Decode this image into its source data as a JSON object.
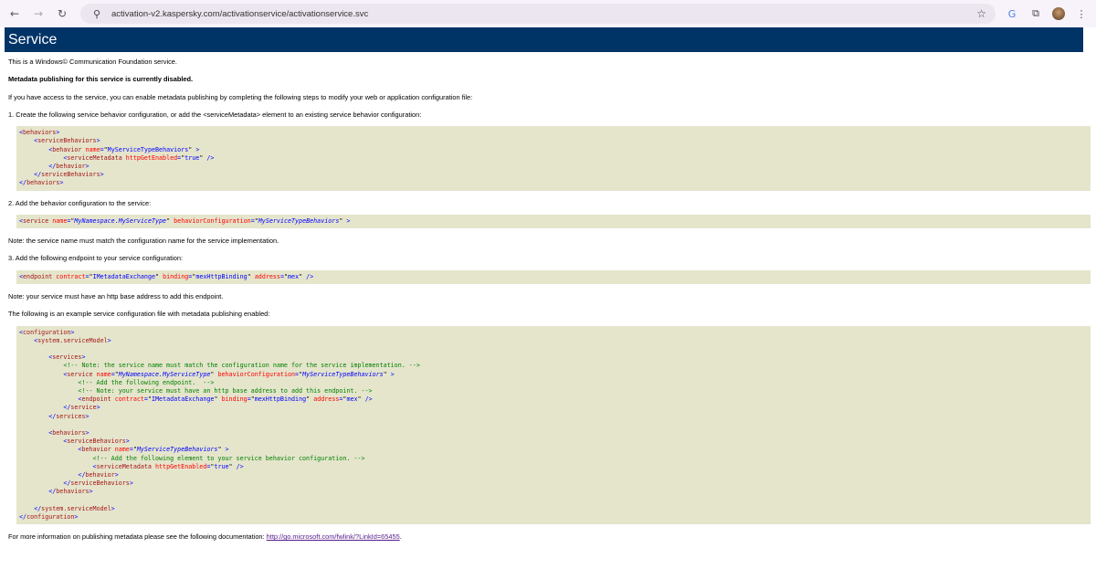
{
  "browser": {
    "url": "activation-v2.kaspersky.com/activationservice/activationservice.svc"
  },
  "page": {
    "title": "Service",
    "intro": "This is a Windows© Communication Foundation service.",
    "disabled": "Metadata publishing for this service is currently disabled.",
    "access": "If you have access to the service, you can enable metadata publishing by completing the following steps to modify your web or application configuration file:",
    "step1": "1. Create the following service behavior configuration, or add the <serviceMetadata> element to an existing service behavior configuration:",
    "step2": "2. Add the behavior configuration to the service:",
    "note1": "Note: the service name must match the configuration name for the service implementation.",
    "step3": "3. Add the following endpoint to your service configuration:",
    "note2": "Note: your service must have an http base address to add this endpoint.",
    "example": "The following is an example service configuration file with metadata publishing enabled:",
    "more": "For more information on publishing metadata please see the following documentation: ",
    "link": "http://go.microsoft.com/fwlink/?LinkId=65455",
    "link_end": "."
  },
  "code1": [
    [
      [
        "br",
        "<"
      ],
      [
        "tg",
        "behaviors"
      ],
      [
        "br",
        ">"
      ]
    ],
    [
      [
        "",
        "    "
      ],
      [
        "br",
        "<"
      ],
      [
        "tg",
        "serviceBehaviors"
      ],
      [
        "br",
        ">"
      ]
    ],
    [
      [
        "",
        "        "
      ],
      [
        "br",
        "<"
      ],
      [
        "tg",
        "behavior "
      ],
      [
        "at",
        "name"
      ],
      [
        "br",
        "="
      ],
      [
        "",
        "\""
      ],
      [
        "vl",
        "MyServiceTypeBehaviors"
      ],
      [
        "",
        "\" "
      ],
      [
        "br",
        ">"
      ]
    ],
    [
      [
        "",
        "            "
      ],
      [
        "br",
        "<"
      ],
      [
        "tg",
        "serviceMetadata "
      ],
      [
        "at",
        "httpGetEnabled"
      ],
      [
        "br",
        "="
      ],
      [
        "",
        "\""
      ],
      [
        "vl",
        "true"
      ],
      [
        "",
        "\" "
      ],
      [
        "br",
        "/>"
      ]
    ],
    [
      [
        "",
        "        "
      ],
      [
        "br",
        "</"
      ],
      [
        "tg",
        "behavior"
      ],
      [
        "br",
        ">"
      ]
    ],
    [
      [
        "",
        "    "
      ],
      [
        "br",
        "</"
      ],
      [
        "tg",
        "serviceBehaviors"
      ],
      [
        "br",
        ">"
      ]
    ],
    [
      [
        "br",
        "</"
      ],
      [
        "tg",
        "behaviors"
      ],
      [
        "br",
        ">"
      ]
    ]
  ],
  "code2": [
    [
      [
        "br",
        "<"
      ],
      [
        "tg",
        "service "
      ],
      [
        "at",
        "name"
      ],
      [
        "br",
        "="
      ],
      [
        "",
        "\""
      ],
      [
        "vl it",
        "MyNamespace.MyServiceType"
      ],
      [
        "",
        "\" "
      ],
      [
        "at",
        "behaviorConfiguration"
      ],
      [
        "br",
        "="
      ],
      [
        "",
        "\""
      ],
      [
        "vl it",
        "MyServiceTypeBehaviors"
      ],
      [
        "",
        "\" "
      ],
      [
        "br",
        ">"
      ]
    ]
  ],
  "code3": [
    [
      [
        "br",
        "<"
      ],
      [
        "tg",
        "endpoint "
      ],
      [
        "at",
        "contract"
      ],
      [
        "br",
        "="
      ],
      [
        "",
        "\""
      ],
      [
        "vl",
        "IMetadataExchange"
      ],
      [
        "",
        "\" "
      ],
      [
        "at",
        "binding"
      ],
      [
        "br",
        "="
      ],
      [
        "",
        "\""
      ],
      [
        "vl",
        "mexHttpBinding"
      ],
      [
        "",
        "\" "
      ],
      [
        "at",
        "address"
      ],
      [
        "br",
        "="
      ],
      [
        "",
        "\""
      ],
      [
        "vl",
        "mex"
      ],
      [
        "",
        "\" "
      ],
      [
        "br",
        "/>"
      ]
    ]
  ],
  "code4": [
    [
      [
        "br",
        "<"
      ],
      [
        "tg",
        "configuration"
      ],
      [
        "br",
        ">"
      ]
    ],
    [
      [
        "",
        "    "
      ],
      [
        "br",
        "<"
      ],
      [
        "tg",
        "system.serviceModel"
      ],
      [
        "br",
        ">"
      ]
    ],
    [
      [
        "",
        ""
      ]
    ],
    [
      [
        "",
        "        "
      ],
      [
        "br",
        "<"
      ],
      [
        "tg",
        "services"
      ],
      [
        "br",
        ">"
      ]
    ],
    [
      [
        "",
        "            "
      ],
      [
        "cm",
        "<!-- Note: the service name must match the configuration name for the service implementation. -->"
      ]
    ],
    [
      [
        "",
        "            "
      ],
      [
        "br",
        "<"
      ],
      [
        "tg",
        "service "
      ],
      [
        "at",
        "name"
      ],
      [
        "br",
        "="
      ],
      [
        "",
        "\""
      ],
      [
        "vl it",
        "MyNamespace.MyServiceType"
      ],
      [
        "",
        "\" "
      ],
      [
        "at",
        "behaviorConfiguration"
      ],
      [
        "br",
        "="
      ],
      [
        "",
        "\""
      ],
      [
        "vl it",
        "MyServiceTypeBehaviors"
      ],
      [
        "",
        "\" "
      ],
      [
        "br",
        ">"
      ]
    ],
    [
      [
        "",
        "                "
      ],
      [
        "cm",
        "<!-- Add the following endpoint.  -->"
      ]
    ],
    [
      [
        "",
        "                "
      ],
      [
        "cm",
        "<!-- Note: your service must have an http base address to add this endpoint. -->"
      ]
    ],
    [
      [
        "",
        "                "
      ],
      [
        "br",
        "<"
      ],
      [
        "tg",
        "endpoint "
      ],
      [
        "at",
        "contract"
      ],
      [
        "br",
        "="
      ],
      [
        "",
        "\""
      ],
      [
        "vl",
        "IMetadataExchange"
      ],
      [
        "",
        "\" "
      ],
      [
        "at",
        "binding"
      ],
      [
        "br",
        "="
      ],
      [
        "",
        "\""
      ],
      [
        "vl",
        "mexHttpBinding"
      ],
      [
        "",
        "\" "
      ],
      [
        "at",
        "address"
      ],
      [
        "br",
        "="
      ],
      [
        "",
        "\""
      ],
      [
        "vl",
        "mex"
      ],
      [
        "",
        "\" "
      ],
      [
        "br",
        "/>"
      ]
    ],
    [
      [
        "",
        "            "
      ],
      [
        "br",
        "</"
      ],
      [
        "tg",
        "service"
      ],
      [
        "br",
        ">"
      ]
    ],
    [
      [
        "",
        "        "
      ],
      [
        "br",
        "</"
      ],
      [
        "tg",
        "services"
      ],
      [
        "br",
        ">"
      ]
    ],
    [
      [
        "",
        ""
      ]
    ],
    [
      [
        "",
        "        "
      ],
      [
        "br",
        "<"
      ],
      [
        "tg",
        "behaviors"
      ],
      [
        "br",
        ">"
      ]
    ],
    [
      [
        "",
        "            "
      ],
      [
        "br",
        "<"
      ],
      [
        "tg",
        "serviceBehaviors"
      ],
      [
        "br",
        ">"
      ]
    ],
    [
      [
        "",
        "                "
      ],
      [
        "br",
        "<"
      ],
      [
        "tg",
        "behavior "
      ],
      [
        "at",
        "name"
      ],
      [
        "br",
        "="
      ],
      [
        "",
        "\""
      ],
      [
        "vl it",
        "MyServiceTypeBehaviors"
      ],
      [
        "",
        "\" "
      ],
      [
        "br",
        ">"
      ]
    ],
    [
      [
        "",
        "                    "
      ],
      [
        "cm",
        "<!-- Add the following element to your service behavior configuration. -->"
      ]
    ],
    [
      [
        "",
        "                    "
      ],
      [
        "br",
        "<"
      ],
      [
        "tg",
        "serviceMetadata "
      ],
      [
        "at",
        "httpGetEnabled"
      ],
      [
        "br",
        "="
      ],
      [
        "",
        "\""
      ],
      [
        "vl",
        "true"
      ],
      [
        "",
        "\" "
      ],
      [
        "br",
        "/>"
      ]
    ],
    [
      [
        "",
        "                "
      ],
      [
        "br",
        "</"
      ],
      [
        "tg",
        "behavior"
      ],
      [
        "br",
        ">"
      ]
    ],
    [
      [
        "",
        "            "
      ],
      [
        "br",
        "</"
      ],
      [
        "tg",
        "serviceBehaviors"
      ],
      [
        "br",
        ">"
      ]
    ],
    [
      [
        "",
        "        "
      ],
      [
        "br",
        "</"
      ],
      [
        "tg",
        "behaviors"
      ],
      [
        "br",
        ">"
      ]
    ],
    [
      [
        "",
        ""
      ]
    ],
    [
      [
        "",
        "    "
      ],
      [
        "br",
        "</"
      ],
      [
        "tg",
        "system.serviceModel"
      ],
      [
        "br",
        ">"
      ]
    ],
    [
      [
        "br",
        "</"
      ],
      [
        "tg",
        "configuration"
      ],
      [
        "br",
        ">"
      ]
    ]
  ]
}
